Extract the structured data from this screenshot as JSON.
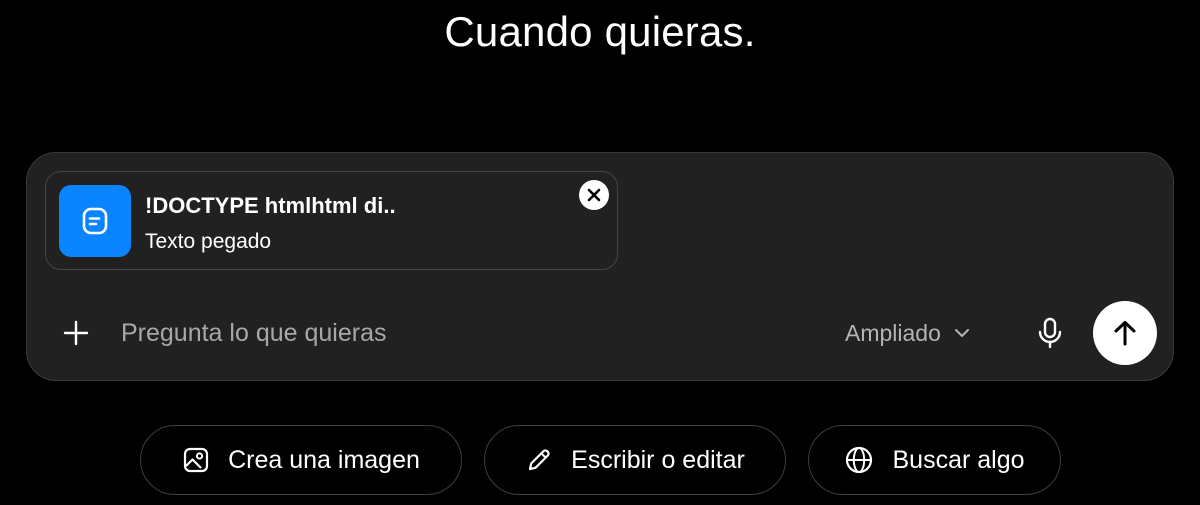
{
  "headline": "Cuando quieras.",
  "attachment": {
    "title": "!DOCTYPE htmlhtml di..",
    "subtitle": "Texto pegado",
    "icon": "document-icon",
    "icon_color": "#0a84ff"
  },
  "composer": {
    "placeholder": "Pregunta lo que quieras",
    "value": "",
    "model_label": "Ampliado",
    "icons": [
      "plus-icon",
      "chevron-down-icon",
      "microphone-icon",
      "arrow-up-icon",
      "close-icon"
    ]
  },
  "suggestions": [
    {
      "label": "Crea una imagen",
      "icon": "image-icon"
    },
    {
      "label": "Escribir o editar",
      "icon": "pencil-icon"
    },
    {
      "label": "Buscar algo",
      "icon": "globe-icon"
    }
  ],
  "colors": {
    "background": "#000000",
    "composer_bg": "#212121",
    "accent": "#0a84ff",
    "send_button": "#ffffff"
  }
}
